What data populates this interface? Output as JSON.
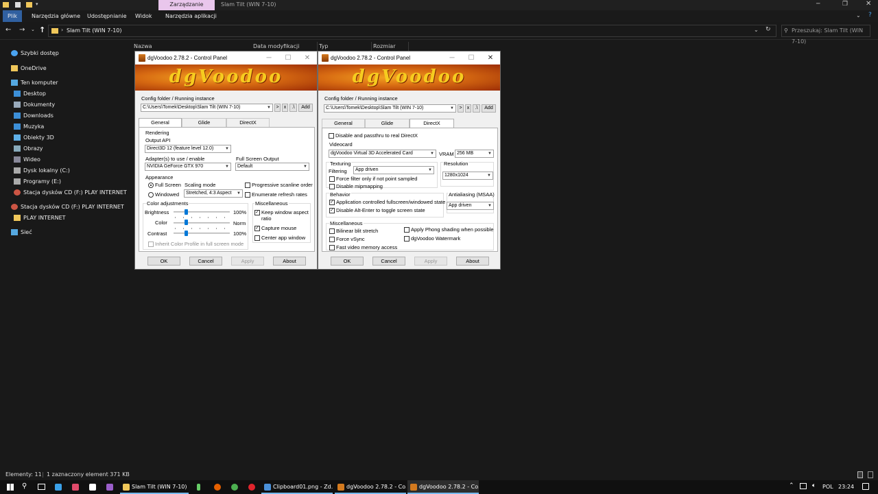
{
  "explorer": {
    "ctx_tab": "Zarządzanie",
    "window_title": "Slam Tilt (WIN 7-10)",
    "ribbon_tabs": [
      "Plik",
      "Narzędzia główne",
      "Udostępnianie",
      "Widok",
      "Narzędzia aplikacji"
    ],
    "address_path": "Slam Tilt (WIN 7-10)",
    "search_placeholder": "Przeszukaj: Slam Tilt (WIN 7-10)",
    "columns": [
      "Nazwa",
      "Data modyfikacji",
      "Typ",
      "Rozmiar"
    ],
    "nav": [
      {
        "label": "Szybki dostęp",
        "icon": "star-icon",
        "color": "#4aa3f0"
      },
      {
        "label": "OneDrive",
        "icon": "folder-icon",
        "color": "#f0c75a"
      },
      {
        "label": "Ten komputer",
        "icon": "computer-icon",
        "color": "#55a8e0"
      },
      {
        "label": "Desktop",
        "icon": "desktop-icon",
        "color": "#3c8fd8"
      },
      {
        "label": "Dokumenty",
        "icon": "documents-icon",
        "color": "#9ab"
      },
      {
        "label": "Downloads",
        "icon": "download-icon",
        "color": "#3c8fd8"
      },
      {
        "label": "Muzyka",
        "icon": "music-icon",
        "color": "#3c8fd8"
      },
      {
        "label": "Obiekty 3D",
        "icon": "cube-icon",
        "color": "#5fb0e8"
      },
      {
        "label": "Obrazy",
        "icon": "pictures-icon",
        "color": "#8ab"
      },
      {
        "label": "Wideo",
        "icon": "video-icon",
        "color": "#889"
      },
      {
        "label": "Dysk lokalny (C:)",
        "icon": "drive-icon",
        "color": "#aaa"
      },
      {
        "label": "Programy (E:)",
        "icon": "drive-icon",
        "color": "#aaa"
      },
      {
        "label": "Stacja dysków CD (F:) PLAY INTERNET",
        "icon": "cd-icon",
        "color": "#c54"
      },
      {
        "label": "Stacja dysków CD (F:) PLAY INTERNET",
        "icon": "cd-icon",
        "color": "#c54"
      },
      {
        "label": "PLAY INTERNET",
        "icon": "folder-icon",
        "color": "#f0c75a"
      },
      {
        "label": "Sieć",
        "icon": "network-icon",
        "color": "#55a8e0"
      }
    ],
    "status_count": "Elementy: 11",
    "status_selected": "1 zaznaczony element  371 KB"
  },
  "dlg1": {
    "title": "dgVoodoo 2.78.2 - Control Panel",
    "banner": "dgVoodoo",
    "config_label": "Config folder / Running instance",
    "config_path": "C:\\Users\\Tomek\\Desktop\\Slam Tilt (WIN 7-10)",
    "btn_gt": ">",
    "btn_x": "x",
    "btn_dot": ".\\",
    "btn_add": "Add",
    "tabs": [
      "General",
      "Glide",
      "DirectX"
    ],
    "rendering": "Rendering",
    "output_api_label": "Output API",
    "output_api": "Direct3D 12 (feature level 12.0)",
    "adapter_label": "Adapter(s) to use / enable",
    "adapter": "NVIDIA GeForce GTX 970",
    "fso_label": "Full Screen Output",
    "fso": "Default",
    "appearance": "Appearance",
    "full_screen": "Full Screen",
    "windowed": "Windowed",
    "scaling_label": "Scaling mode",
    "scaling": "Stretched, 4:3 Aspect",
    "progressive": "Progressive scanline order",
    "enumerate": "Enumerate refresh rates",
    "color_adj": "Color adjustments",
    "brightness": "Brightness",
    "color": "Color",
    "contrast": "Contrast",
    "brightness_val": "100%",
    "color_val": "Norm",
    "contrast_val": "100%",
    "inherit": "Inherit Color Profile in full screen mode",
    "misc": "Miscellaneous",
    "keep_aspect_1": "Keep window aspect",
    "keep_aspect_2": "ratio",
    "capture_mouse": "Capture mouse",
    "center_app": "Center app window",
    "ok": "OK",
    "cancel": "Cancel",
    "apply": "Apply",
    "about": "About"
  },
  "dlg2": {
    "title": "dgVoodoo 2.78.2 - Control Panel",
    "banner": "dgVoodoo",
    "config_label": "Config folder / Running instance",
    "config_path": "C:\\Users\\Tomek\\Desktop\\Slam Tilt (WIN 7-10)",
    "btn_gt": ">",
    "btn_x": "x",
    "btn_dot": ".\\",
    "btn_add": "Add",
    "tabs": [
      "General",
      "Glide",
      "DirectX"
    ],
    "disable_passthru": "Disable and passthru to real DirectX",
    "videocard": "Videocard",
    "videocard_val": "dgVoodoo Virtual 3D Accelerated Card",
    "vram_label": "VRAM",
    "vram": "256 MB",
    "texturing": "Texturing",
    "filtering_label": "Filtering",
    "filtering": "App driven",
    "resolution_label": "Resolution",
    "resolution": "1280x1024",
    "force_filter": "Force filter only if not point sampled",
    "disable_mip": "Disable mipmapping",
    "behavior": "Behavior",
    "app_controlled": "Application controlled fullscreen/windowed state",
    "disable_alt": "Disable Alt-Enter to toggle screen state",
    "aa_label": "Antialiasing (MSAA)",
    "aa": "App driven",
    "misc": "Miscellaneous",
    "bilinear": "Bilinear blit stretch",
    "force_vsync": "Force vSync",
    "fast_vmem": "Fast video memory access",
    "phong": "Apply Phong shading when possible",
    "watermark": "dgVoodoo Watermark",
    "ok": "OK",
    "cancel": "Cancel",
    "apply": "Apply",
    "about": "About"
  },
  "taskbar": {
    "items": [
      {
        "label": "Slam Tilt (WIN 7-10)"
      },
      {
        "label": "Clipboard01.png - Zd..."
      },
      {
        "label": "dgVoodoo 2.78.2 - Co..."
      },
      {
        "label": "dgVoodoo 2.78.2 - Co..."
      }
    ],
    "lang": "POL",
    "time": "23:24"
  }
}
